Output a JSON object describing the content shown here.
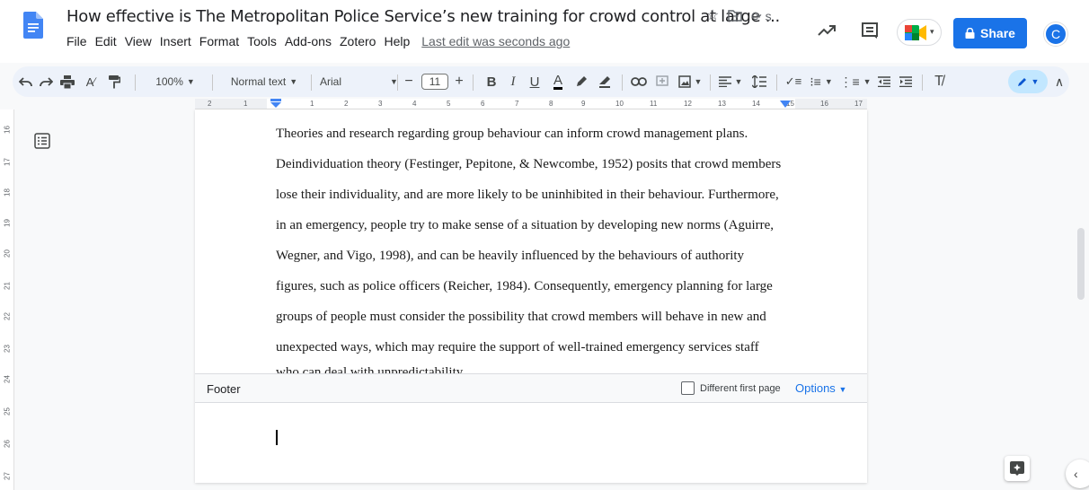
{
  "header": {
    "title": "How effective is The Metropolitan Police Service’s new training for crowd control at large ...",
    "menu": [
      "File",
      "Edit",
      "View",
      "Insert",
      "Format",
      "Tools",
      "Add-ons",
      "Zotero",
      "Help"
    ],
    "last_edit": "Last edit was seconds ago",
    "share_label": "Share",
    "avatar_initial": "C",
    "brand_color": "#1a73e8"
  },
  "toolbar": {
    "zoom": "100%",
    "style": "Normal text",
    "font": "Arial",
    "font_size": "11"
  },
  "ruler": {
    "h_ticks": [
      "2",
      "1",
      "1",
      "2",
      "3",
      "4",
      "5",
      "6",
      "7",
      "8",
      "9",
      "10",
      "11",
      "12",
      "13",
      "14",
      "15",
      "16",
      "17",
      "18"
    ],
    "v_ticks": [
      "16",
      "17",
      "18",
      "19",
      "20",
      "21",
      "22",
      "23",
      "24",
      "25",
      "26",
      "27"
    ]
  },
  "document": {
    "lines": [
      "Theories and research regarding group behaviour can inform crowd management plans.",
      "Deindividuation theory (Festinger, Pepitone, & Newcombe, 1952) posits that crowd members",
      "lose their individuality, and are more likely to be uninhibited in their behaviour.  Furthermore,",
      "in an emergency, people try to make sense of a situation by developing new norms (Aguirre,",
      "Wegner, and Vigo, 1998), and can be heavily influenced by the behaviours of authority",
      "figures, such as police officers (Reicher, 1984).  Consequently, emergency planning for large",
      "groups of people must consider the possibility that crowd members will behave in new and",
      "unexpected ways, which may require the support of well-trained emergency services staff"
    ],
    "cutoff_line": "who can deal with unpredictability."
  },
  "footer": {
    "label": "Footer",
    "different_first_page": "Different first page",
    "options": "Options"
  }
}
